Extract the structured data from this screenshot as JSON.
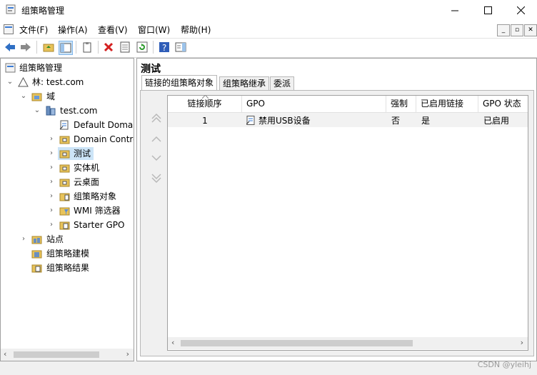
{
  "window": {
    "title": "组策略管理"
  },
  "menu": [
    "文件(F)",
    "操作(A)",
    "查看(V)",
    "窗口(W)",
    "帮助(H)"
  ],
  "tree": {
    "root": "组策略管理",
    "forest": "林: test.com",
    "domains": "域",
    "domain": "test.com",
    "children": [
      "Default Domai",
      "Domain Contro",
      "测试",
      "实体机",
      "云桌面",
      "组策略对象",
      "WMI 筛选器",
      "Starter GPO"
    ],
    "sites": "站点",
    "modeling": "组策略建模",
    "results": "组策略结果"
  },
  "main": {
    "title": "测试",
    "tabs": [
      "链接的组策略对象",
      "组策略继承",
      "委派"
    ],
    "columns": [
      "链接顺序",
      "GPO",
      "强制",
      "已启用链接",
      "GPO 状态"
    ],
    "rows": [
      {
        "order": "1",
        "gpo": "禁用USB设备",
        "enforced": "否",
        "link_enabled": "是",
        "status": "已启用"
      }
    ]
  },
  "watermark": "CSDN @yleihj"
}
